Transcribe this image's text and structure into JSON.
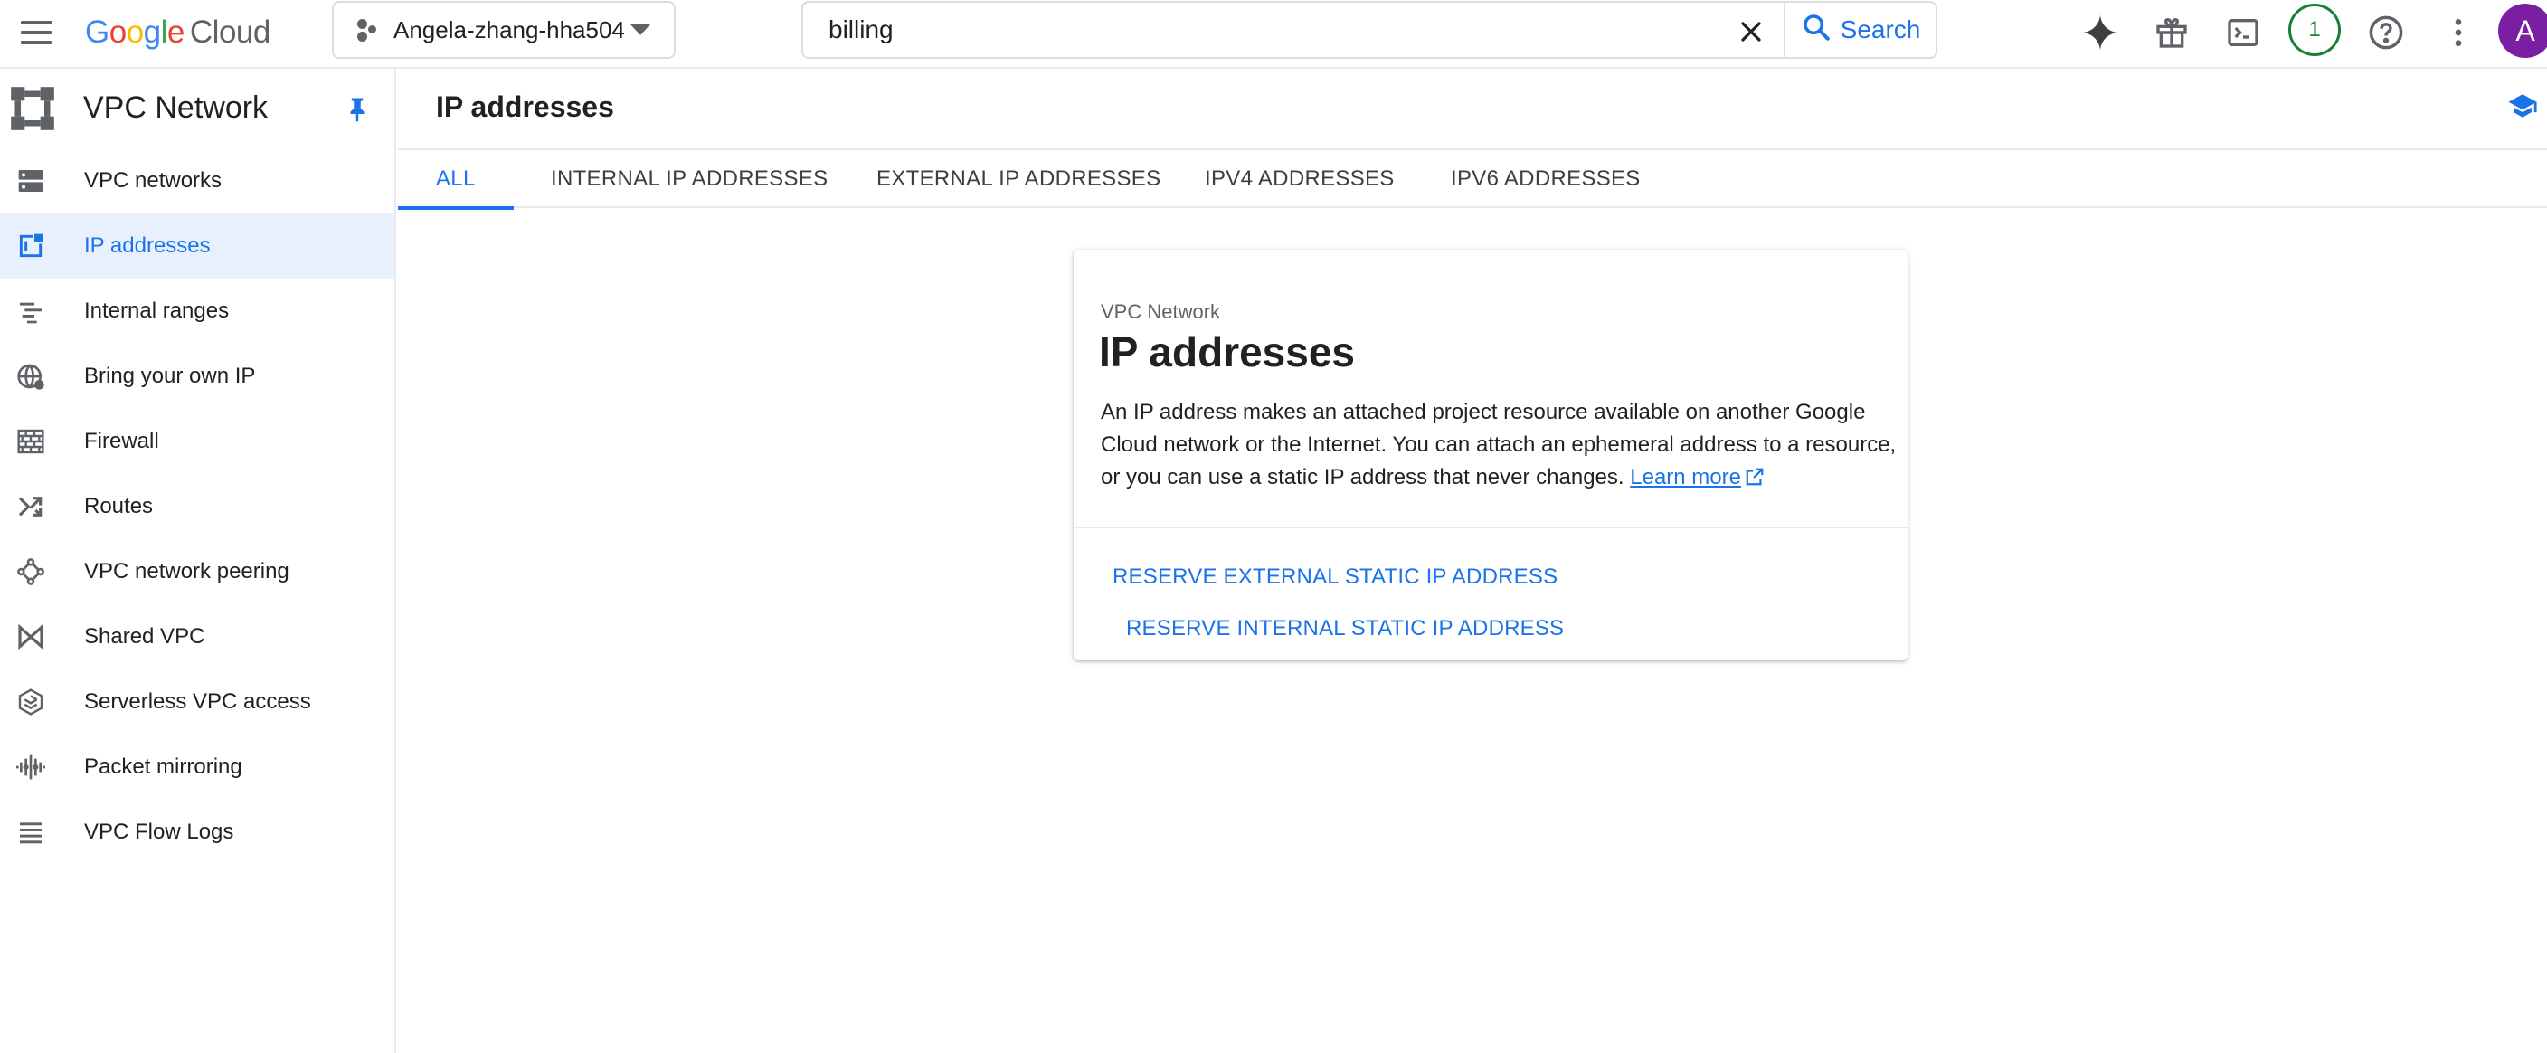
{
  "header": {
    "logo": {
      "letters": [
        "G",
        "o",
        "o",
        "g",
        "l",
        "e"
      ],
      "cloud": "Cloud"
    },
    "project_name": "Angela-zhang-hha504",
    "search": {
      "value": "billing",
      "button_label": "Search"
    },
    "notification_count": "1",
    "avatar_initial": "A",
    "icons": [
      "menu-icon",
      "project-icon",
      "dropdown-caret-icon",
      "clear-icon",
      "search-icon",
      "gemini-icon",
      "gift-icon",
      "cloud-shell-icon",
      "help-icon",
      "more-vert-icon"
    ]
  },
  "sidebar": {
    "product_title": "VPC Network",
    "items": [
      {
        "label": "VPC networks",
        "icon": "vpc-networks-icon"
      },
      {
        "label": "IP addresses",
        "icon": "ip-addresses-icon",
        "active": true
      },
      {
        "label": "Internal ranges",
        "icon": "internal-ranges-icon"
      },
      {
        "label": "Bring your own IP",
        "icon": "globe-icon"
      },
      {
        "label": "Firewall",
        "icon": "firewall-icon"
      },
      {
        "label": "Routes",
        "icon": "routes-icon"
      },
      {
        "label": "VPC network peering",
        "icon": "peering-icon"
      },
      {
        "label": "Shared VPC",
        "icon": "shared-vpc-icon"
      },
      {
        "label": "Serverless VPC access",
        "icon": "serverless-icon"
      },
      {
        "label": "Packet mirroring",
        "icon": "packet-mirroring-icon"
      },
      {
        "label": "VPC Flow Logs",
        "icon": "flow-logs-icon"
      }
    ]
  },
  "main": {
    "title": "IP addresses",
    "tabs": [
      {
        "label": "ALL",
        "active": true
      },
      {
        "label": "INTERNAL IP ADDRESSES"
      },
      {
        "label": "EXTERNAL IP ADDRESSES"
      },
      {
        "label": "IPV4 ADDRESSES"
      },
      {
        "label": "IPV6 ADDRESSES"
      }
    ],
    "card": {
      "eyebrow": "VPC Network",
      "title": "IP addresses",
      "description": "An IP address makes an attached project resource available on another Google Cloud network or the Internet. You can attach an ephemeral address to a resource, or you can use a static IP address that never changes.",
      "learn_more": "Learn more",
      "actions": {
        "reserve_external": "RESERVE EXTERNAL STATIC IP ADDRESS",
        "reserve_internal": "RESERVE INTERNAL STATIC IP ADDRESS"
      }
    }
  },
  "colors": {
    "accent": "#1a73e8",
    "active_bg": "#e8f0fe",
    "text": "#202124",
    "secondary_text": "#5f6368",
    "border": "#dadce0",
    "notification_green": "#188038",
    "avatar_bg": "#7b1fa2"
  }
}
